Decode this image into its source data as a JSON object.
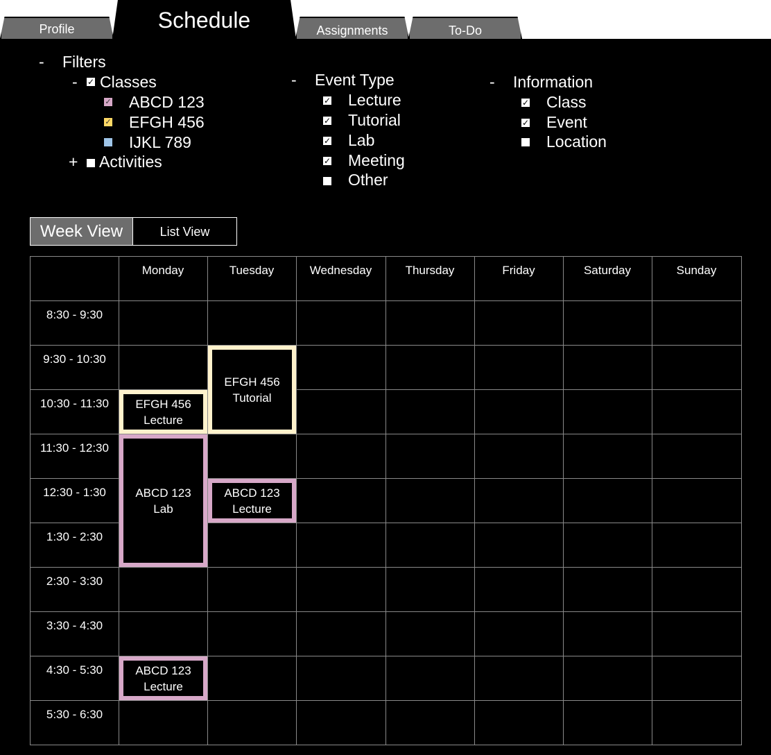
{
  "tabs": {
    "profile": "Profile",
    "schedule": "Schedule",
    "assignments": "Assignments",
    "todo": "To-Do"
  },
  "filters": {
    "toggle": "-",
    "title": "Filters",
    "classes": {
      "toggle": "-",
      "label": "Classes",
      "checked": true,
      "items": [
        {
          "label": "ABCD 123",
          "color": "#d7a8c8",
          "checked": true
        },
        {
          "label": "EFGH 456",
          "color": "#ffd966",
          "checked": true
        },
        {
          "label": "IJKL 789",
          "color": "#9fc5e8",
          "checked": false
        }
      ]
    },
    "activities": {
      "toggle": "+",
      "label": "Activities",
      "checked": false
    }
  },
  "event_type": {
    "toggle": "-",
    "title": "Event Type",
    "items": [
      {
        "label": "Lecture",
        "checked": true
      },
      {
        "label": "Tutorial",
        "checked": true
      },
      {
        "label": "Lab",
        "checked": true
      },
      {
        "label": "Meeting",
        "checked": true
      },
      {
        "label": "Other",
        "checked": false
      }
    ]
  },
  "information": {
    "toggle": "-",
    "title": "Information",
    "items": [
      {
        "label": "Class",
        "checked": true
      },
      {
        "label": "Event",
        "checked": true
      },
      {
        "label": "Location",
        "checked": false
      }
    ]
  },
  "views": {
    "week": "Week View",
    "list": "List View",
    "selected": "week"
  },
  "schedule": {
    "days": [
      "Monday",
      "Tuesday",
      "Wednesday",
      "Thursday",
      "Friday",
      "Saturday",
      "Sunday"
    ],
    "times": [
      "8:30 - 9:30",
      "9:30 - 10:30",
      "10:30 - 11:30",
      "11:30 - 12:30",
      "12:30 - 1:30",
      "1:30 - 2:30",
      "2:30 - 3:30",
      "3:30 - 4:30",
      "4:30 - 5:30",
      "5:30 - 6:30"
    ],
    "events": [
      {
        "text": "EFGH 456\nTutorial",
        "day": "Tuesday",
        "start": "9:30",
        "end": "11:30",
        "color": "#fff2cc"
      },
      {
        "text": "EFGH 456\nLecture",
        "day": "Monday",
        "start": "10:30",
        "end": "11:30",
        "color": "#fff2cc"
      },
      {
        "text": "ABCD 123\nLab",
        "day": "Monday",
        "start": "11:30",
        "end": "2:30",
        "color": "#d7a8c8"
      },
      {
        "text": "ABCD 123\nLecture",
        "day": "Tuesday",
        "start": "12:30",
        "end": "1:30",
        "color": "#d7a8c8"
      },
      {
        "text": "ABCD 123\nLecture",
        "day": "Monday",
        "start": "4:30",
        "end": "5:30",
        "color": "#d7a8c8"
      }
    ]
  }
}
